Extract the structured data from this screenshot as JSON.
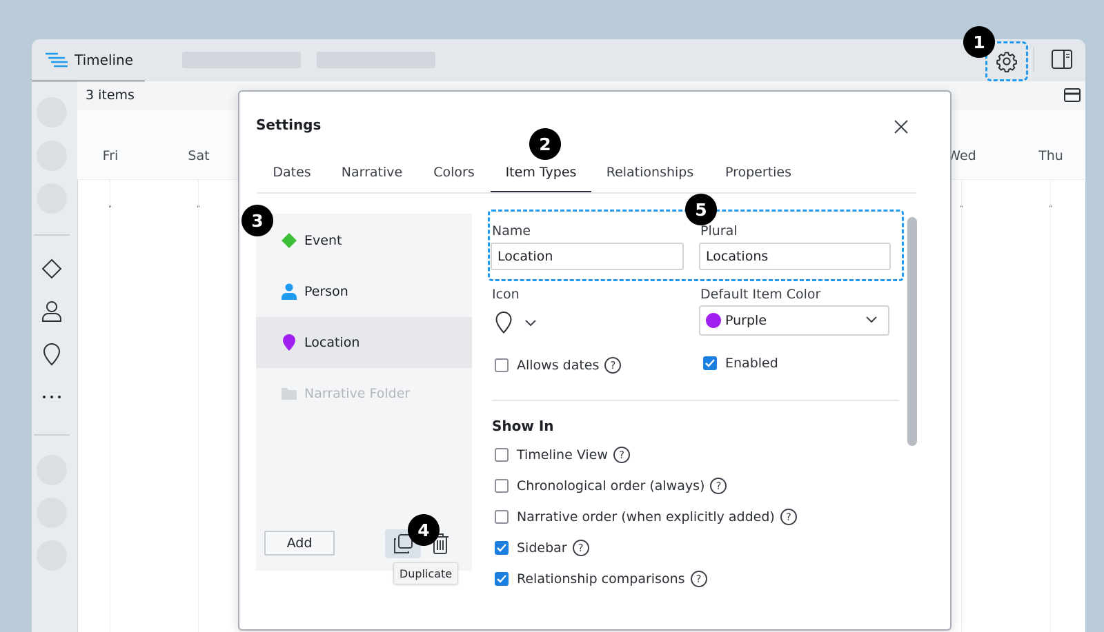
{
  "topbar": {
    "tab_label": "Timeline"
  },
  "items_bar": {
    "count": "3 items"
  },
  "days": [
    "Fri",
    "Sat",
    "Wed",
    "Thu"
  ],
  "settings": {
    "title": "Settings",
    "tabs": [
      "Dates",
      "Narrative",
      "Colors",
      "Item Types",
      "Relationships",
      "Properties"
    ],
    "active_tab": "Item Types",
    "item_types": [
      {
        "label": "Event",
        "icon": "diamond-icon",
        "color": "#3bbf3b"
      },
      {
        "label": "Person",
        "icon": "person-icon",
        "color": "#1e9bf0"
      },
      {
        "label": "Location",
        "icon": "location-pin-icon",
        "color": "#a020f0",
        "selected": true
      },
      {
        "label": "Narrative Folder",
        "icon": "folder-icon",
        "disabled": true
      }
    ],
    "add_label": "Add",
    "tooltip": "Duplicate",
    "form": {
      "name_label": "Name",
      "name_value": "Location",
      "plural_label": "Plural",
      "plural_value": "Locations",
      "icon_label": "Icon",
      "color_label": "Default Item Color",
      "color_value": "Purple",
      "color_hex": "#a020f0",
      "allows_dates_label": "Allows dates",
      "allows_dates_checked": false,
      "enabled_label": "Enabled",
      "enabled_checked": true,
      "show_in_title": "Show In",
      "show_in": [
        {
          "label": "Timeline View",
          "checked": false
        },
        {
          "label": "Chronological order (always)",
          "checked": false
        },
        {
          "label": "Narrative order (when explicitly added)",
          "checked": false
        },
        {
          "label": "Sidebar",
          "checked": true
        },
        {
          "label": "Relationship comparisons",
          "checked": true
        }
      ]
    }
  },
  "badges": [
    "1",
    "2",
    "3",
    "4",
    "5"
  ],
  "colors": {
    "accent": "#1e9bf0",
    "checkbox": "#1a7fe0"
  }
}
